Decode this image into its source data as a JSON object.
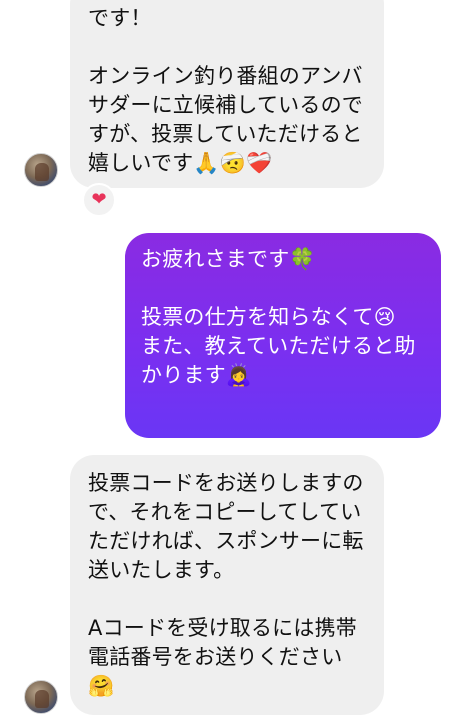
{
  "messages": [
    {
      "sender": "other",
      "text": "です！\n\nオンライン釣り番組のアンバサダーに立候補しているのですが、投票していただけると嬉しいです🙏🤕❤️‍🩹"
    },
    {
      "sender": "me",
      "text": "お疲れさまです🍀\n\n投票の仕方を知らなくて😢\nまた、教えていただけると助かります🙇‍♀️"
    },
    {
      "sender": "other",
      "text": "投票コードをお送りしますので、それをコピーしてしていただければ、スポンサーに転送いたします。\n\nAコードを受け取るには携帯電話番号をお送りください🤗"
    }
  ],
  "reaction": {
    "icon": "heart-icon",
    "glyph": "❤",
    "color": "#e8335a"
  },
  "colors": {
    "incoming_bubble": "#efefef",
    "outgoing_gradient_top": "#8a2be2",
    "outgoing_gradient_bottom": "#6a36f5"
  }
}
